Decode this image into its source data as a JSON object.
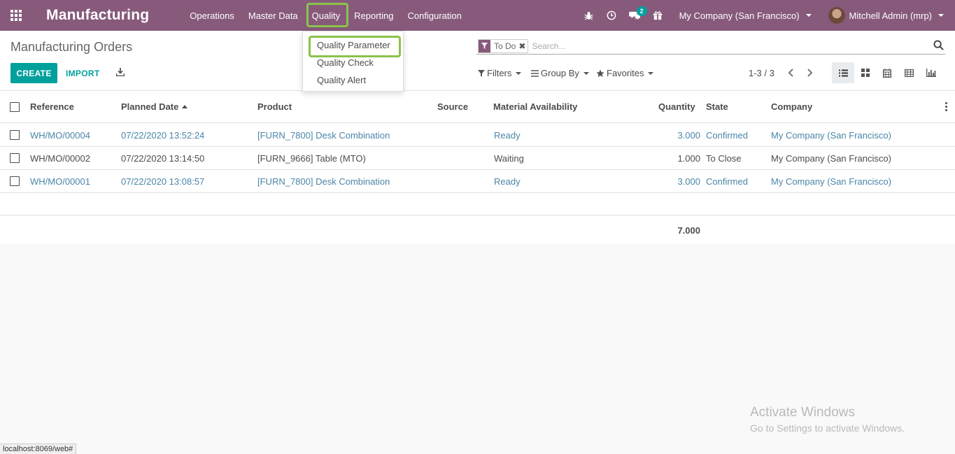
{
  "app": {
    "title": "Manufacturing"
  },
  "nav": {
    "menus": [
      "Operations",
      "Master Data",
      "Quality",
      "Reporting",
      "Configuration"
    ],
    "active_menu": "Quality",
    "messages_badge": "2",
    "company": "My Company (San Francisco)",
    "user": "Mitchell Admin (mrp)"
  },
  "quality_dropdown": {
    "items": [
      "Quality Parameter",
      "Quality Check",
      "Quality Alert"
    ],
    "highlighted": "Quality Parameter"
  },
  "control_panel": {
    "breadcrumb": "Manufacturing Orders",
    "create_label": "CREATE",
    "import_label": "IMPORT",
    "facet_value": "To Do",
    "search_placeholder": "Search...",
    "filters_label": "Filters",
    "groupby_label": "Group By",
    "favorites_label": "Favorites",
    "pager": "1-3 / 3"
  },
  "table": {
    "columns": [
      "Reference",
      "Planned Date",
      "Product",
      "Source",
      "Material Availability",
      "Quantity",
      "State",
      "Company"
    ],
    "rows": [
      {
        "reference": "WH/MO/00004",
        "planned_date": "07/22/2020 13:52:24",
        "product": "[FURN_7800] Desk Combination",
        "source": "",
        "availability": "Ready",
        "quantity": "3.000",
        "state": "Confirmed",
        "company": "My Company (San Francisco)",
        "style": "link"
      },
      {
        "reference": "WH/MO/00002",
        "planned_date": "07/22/2020 13:14:50",
        "product": "[FURN_9666] Table (MTO)",
        "source": "",
        "availability": "Waiting",
        "quantity": "1.000",
        "state": "To Close",
        "company": "My Company (San Francisco)",
        "style": "plain"
      },
      {
        "reference": "WH/MO/00001",
        "planned_date": "07/22/2020 13:08:57",
        "product": "[FURN_7800] Desk Combination",
        "source": "",
        "availability": "Ready",
        "quantity": "3.000",
        "state": "Confirmed",
        "company": "My Company (San Francisco)",
        "style": "link"
      }
    ],
    "total_quantity": "7.000"
  },
  "watermark": {
    "title": "Activate Windows",
    "subtitle": "Go to Settings to activate Windows."
  },
  "statusbar": {
    "url": "localhost:8069/web#"
  },
  "colors": {
    "navbar": "#875a7b",
    "primary": "#00a09d",
    "link": "#4a86a8",
    "highlight": "#8bc34a"
  },
  "icons": [
    "apps-icon",
    "bug-icon",
    "clock-icon",
    "chat-icon",
    "gift-icon",
    "filter-icon",
    "remove-icon",
    "search-icon",
    "download-icon",
    "list-view-icon",
    "kanban-view-icon",
    "calendar-view-icon",
    "pivot-view-icon",
    "graph-view-icon",
    "chevron-left-icon",
    "chevron-right-icon",
    "star-icon",
    "bars-icon",
    "kebab-icon"
  ]
}
